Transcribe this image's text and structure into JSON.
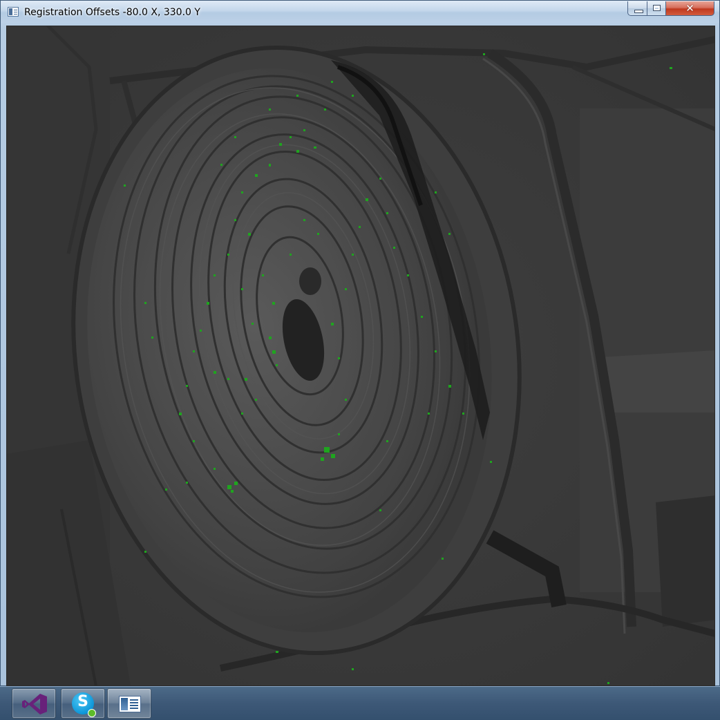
{
  "window": {
    "title": "Registration Offsets -80.0 X, 330.0 Y",
    "app_icon": "app-window-icon",
    "controls": {
      "minimize_icon": "minimize-icon",
      "maximize_icon": "maximize-icon",
      "close_label": "✕"
    }
  },
  "image": {
    "description_icon": "aerial-mine-pit-image",
    "overlay_color": "#1f9a1f",
    "base_tone": "#3a3a3a"
  },
  "taskbar": {
    "items": [
      {
        "name": "visual-studio",
        "icon": "visual-studio-icon"
      },
      {
        "name": "skype",
        "icon": "skype-icon",
        "letter": "S"
      },
      {
        "name": "registration-app",
        "icon": "registration-app-icon"
      }
    ]
  },
  "colors": {
    "titlebar": "#c4d7eb",
    "close_button": "#c0391f",
    "taskbar": "#3d5877",
    "vs_purple": "#68217a",
    "skype_blue": "#0d96d8"
  }
}
